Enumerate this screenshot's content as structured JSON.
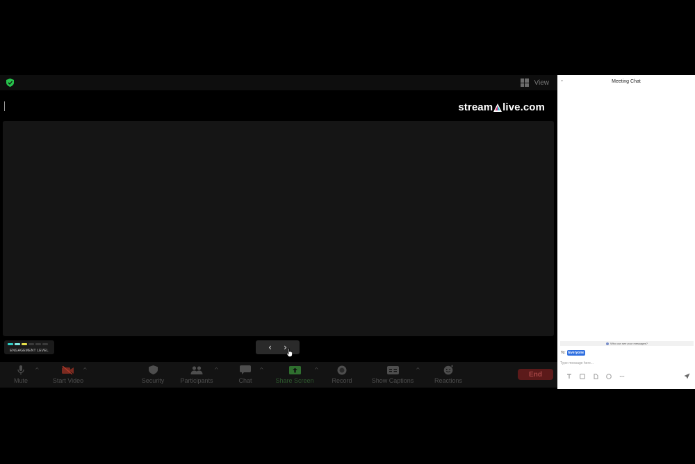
{
  "topbar": {
    "view_label": "View"
  },
  "branding": {
    "logo_prefix": "stream",
    "logo_suffix": "live.com"
  },
  "engagement": {
    "label": "ENGAGEMENT LEVEL",
    "levels_total": 6,
    "levels_filled": 3,
    "colors": [
      "#2fd0c8",
      "#7fe7e0",
      "#e6e04a",
      "#3a3a3a",
      "#3a3a3a",
      "#3a3a3a"
    ]
  },
  "pager": {
    "prev": "‹",
    "next": "›"
  },
  "toolbar": {
    "mute": "Mute",
    "start_video": "Start Video",
    "security": "Security",
    "participants": "Participants",
    "chat": "Chat",
    "share_screen": "Share Screen",
    "record": "Record",
    "show_captions": "Show Captions",
    "reactions": "Reactions",
    "end": "End"
  },
  "chat": {
    "title": "Meeting Chat",
    "who_can_see": "Who can see your messages?",
    "to_label": "To:",
    "recipient": "Everyone",
    "placeholder": "Type message here..."
  },
  "colors": {
    "share_screen_green": "#3e9a3e",
    "start_video_red": "#b23a2a",
    "end_red": "#5c1a1a",
    "chip_blue": "#2f6fe0",
    "shield_green": "#27c24c"
  }
}
